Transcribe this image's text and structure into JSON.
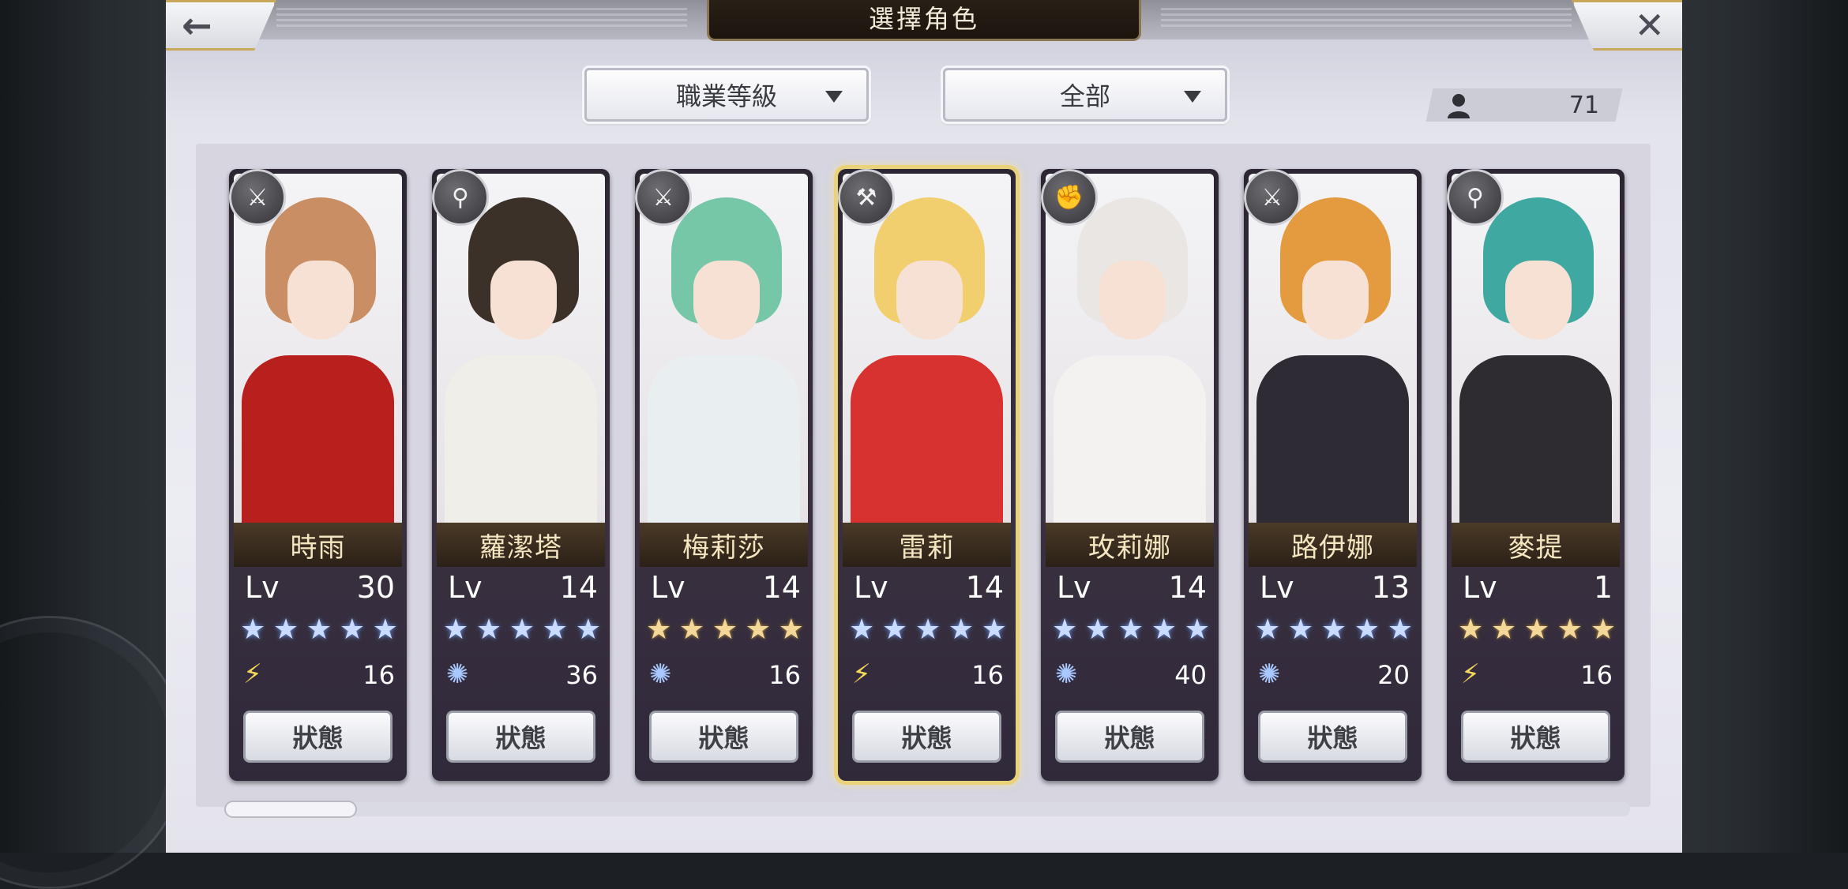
{
  "header": {
    "title": "選擇角色",
    "back_symbol": "←",
    "close_symbol": "✕"
  },
  "filters": {
    "sort": "職業等級",
    "category": "全部"
  },
  "character_count": "71",
  "colors": {
    "accent_gold": "#e9d27a",
    "panel": "#ececf3"
  },
  "characters": [
    {
      "name": "時雨",
      "lv_label": "Lv",
      "level": "30",
      "stars": "★★★★★",
      "star_color": "blue",
      "attribute": "wind-icon",
      "attr_glyph": "⚡",
      "attr_value": "16",
      "class_icon": "sword-icon",
      "class_glyph": "⚔",
      "status": "狀態",
      "selected": false,
      "hair": "#c98e63",
      "body": "#b8201e"
    },
    {
      "name": "蘿潔塔",
      "lv_label": "Lv",
      "level": "14",
      "stars": "★★★★★",
      "star_color": "blue",
      "attribute": "water-icon",
      "attr_glyph": "✺",
      "attr_value": "36",
      "class_icon": "staff-icon",
      "class_glyph": "⚲",
      "status": "狀態",
      "selected": false,
      "hair": "#3b3129",
      "body": "#efeee8"
    },
    {
      "name": "梅莉莎",
      "lv_label": "Lv",
      "level": "14",
      "stars": "★★★★★",
      "star_color": "gold",
      "attribute": "water-icon",
      "attr_glyph": "✺",
      "attr_value": "16",
      "class_icon": "blade-icon",
      "class_glyph": "⚔",
      "status": "狀態",
      "selected": false,
      "hair": "#76c7a7",
      "body": "#e9eef0"
    },
    {
      "name": "雷莉",
      "lv_label": "Lv",
      "level": "14",
      "stars": "★★★★★",
      "star_color": "blue",
      "attribute": "wind-icon",
      "attr_glyph": "⚡",
      "attr_value": "16",
      "class_icon": "axe-icon",
      "class_glyph": "⚒",
      "status": "狀態",
      "selected": true,
      "hair": "#f1cf6e",
      "body": "#d83230"
    },
    {
      "name": "玫莉娜",
      "lv_label": "Lv",
      "level": "14",
      "stars": "★★★★★",
      "star_color": "blue",
      "attribute": "water-icon",
      "attr_glyph": "✺",
      "attr_value": "40",
      "class_icon": "fist-icon",
      "class_glyph": "✊",
      "status": "狀態",
      "selected": false,
      "hair": "#e9e6e4",
      "body": "#f4f2f0"
    },
    {
      "name": "路伊娜",
      "lv_label": "Lv",
      "level": "13",
      "stars": "★★★★★",
      "star_color": "blue",
      "attribute": "water-icon",
      "attr_glyph": "✺",
      "attr_value": "20",
      "class_icon": "lance-icon",
      "class_glyph": "⚔",
      "status": "狀態",
      "selected": false,
      "hair": "#e49a3f",
      "body": "#2f2b35"
    },
    {
      "name": "麥提",
      "lv_label": "Lv",
      "level": "1",
      "stars": "★★★★★",
      "star_color": "gold",
      "attribute": "wind-icon",
      "attr_glyph": "⚡",
      "attr_value": "16",
      "class_icon": "staff-icon",
      "class_glyph": "⚲",
      "status": "狀態",
      "selected": false,
      "hair": "#3fa9a1",
      "body": "#2e2b31"
    }
  ]
}
